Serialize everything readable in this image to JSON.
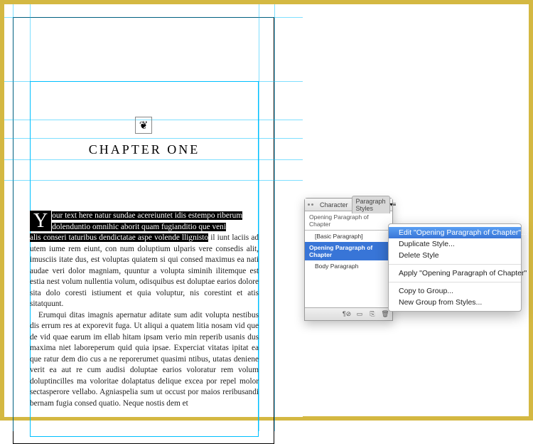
{
  "document": {
    "ornament_glyph": "❦",
    "chapter_title": "CHAPTER ONE",
    "drop_cap": "Y",
    "para1_sel_line1": "our text here natur sundae acereiuntet idis estempo riberum",
    "para1_sel_line2": "dolenduntio omnihic aborit quam fugianditio que veni",
    "para1_sel_line3a": "alis conseri taturibus dendictatae aspe volende llignisto",
    "para1_rest": " il iunt laciis ad utem iume rem eiunt, con num doluptium ulparis vere consedis alit, imusciis itate dus, est voluptas quiatem si qui consed maximus ea nati audae veri dolor magniam, quuntur a volupta siminih ilitemque est estia nest volum nullentia volum, odisquibus est doluptae earios dolore sita dolo coresti istiument et quia voluptur, nis corestint et atis sitatquunt.",
    "para2": "Erumqui ditas imagnis apernatur aditate sum adit volupta nestibus dis errum res at exporevit fuga. Ut aliqui a quatem litia nosam vid que de vid quae earum im ellab hitam ipsam verio min reperib usanis dus maxima niet laboreperum quid quia ipsae. Experciat vitatas ipitat ea que ratur dem dio cus a ne reporerumet quasimi ntibus, utatas deniene verit ea aut re cum audisi doluptae earios voloratur rem volum doluptincilles ma voloritae dolaptatus delique excea por repel molor sectasperore vellabo. Agniaspelia sum ut occust por maios reribusandi bernam fugia consed quatio. Neque nostis dem et"
  },
  "panel": {
    "tab_character": "Character",
    "tab_paragraph": "Paragraph Styles",
    "current_style": "Opening Paragraph of Chapter",
    "styles": {
      "basic": "[Basic Paragraph]",
      "opening": "Opening Paragraph of Chapter",
      "body": "Body Paragraph"
    }
  },
  "context_menu": {
    "edit": "Edit \"Opening Paragraph of Chapter\"...",
    "duplicate": "Duplicate Style...",
    "delete": "Delete Style",
    "apply": "Apply \"Opening Paragraph of Chapter\"",
    "copy_to_group": "Copy to Group...",
    "new_group": "New Group from Styles..."
  }
}
